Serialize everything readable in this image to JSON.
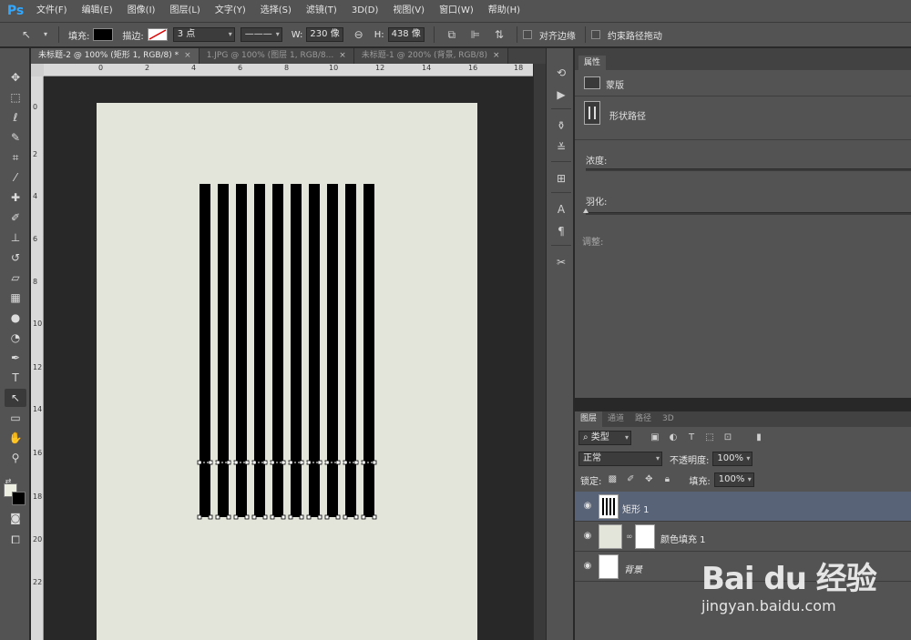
{
  "app": {
    "logo": "Ps"
  },
  "menu": [
    "文件(F)",
    "编辑(E)",
    "图像(I)",
    "图层(L)",
    "文字(Y)",
    "选择(S)",
    "滤镜(T)",
    "3D(D)",
    "视图(V)",
    "窗口(W)",
    "帮助(H)"
  ],
  "options": {
    "fill_label": "填充:",
    "stroke_label": "描边:",
    "stroke_width": "3 点",
    "w_label": "W:",
    "w_value": "230 像",
    "h_label": "H:",
    "h_value": "438 像",
    "align_edges": "对齐边缘",
    "constrain_path": "约束路径拖动"
  },
  "tabs": [
    {
      "label": "未标题-2 @ 100% (矩形 1, RGB/8) *",
      "active": true
    },
    {
      "label": "1.JPG @ 100% (图层 1, RGB/8...",
      "active": false
    },
    {
      "label": "未标题-1 @ 200% (背景, RGB/8)",
      "active": false
    }
  ],
  "ruler": {
    "h": [
      "0",
      "2",
      "4",
      "6",
      "8",
      "10",
      "12",
      "14",
      "16",
      "18"
    ],
    "v": [
      "0",
      "2",
      "4",
      "6",
      "8",
      "10",
      "12",
      "14",
      "16",
      "18",
      "20",
      "22"
    ]
  },
  "colors": {
    "canvas_bg": "#e3e4da",
    "stripe": "#000000",
    "selected_layer": "#596377"
  },
  "canvas": {
    "stripe_count": 10
  },
  "properties": {
    "tab": "属性",
    "mask_label": "蒙版",
    "shape_path": "形状路径",
    "density": "浓度:",
    "feather": "羽化:",
    "adjust": "调整:"
  },
  "layers": {
    "tabs": [
      "图层",
      "通道",
      "路径",
      "3D"
    ],
    "filter_kind": "类型",
    "blend_mode": "正常",
    "opacity_label": "不透明度:",
    "opacity_value": "100%",
    "lock_label": "锁定:",
    "fill_label": "填充:",
    "fill_value": "100%",
    "items": [
      {
        "name": "矩形 1",
        "selected": true
      },
      {
        "name": "颜色填充 1",
        "selected": false
      },
      {
        "name": "背景",
        "selected": false
      }
    ]
  },
  "watermark": {
    "brand": "Bai du 经验",
    "url": "jingyan.baidu.com"
  }
}
